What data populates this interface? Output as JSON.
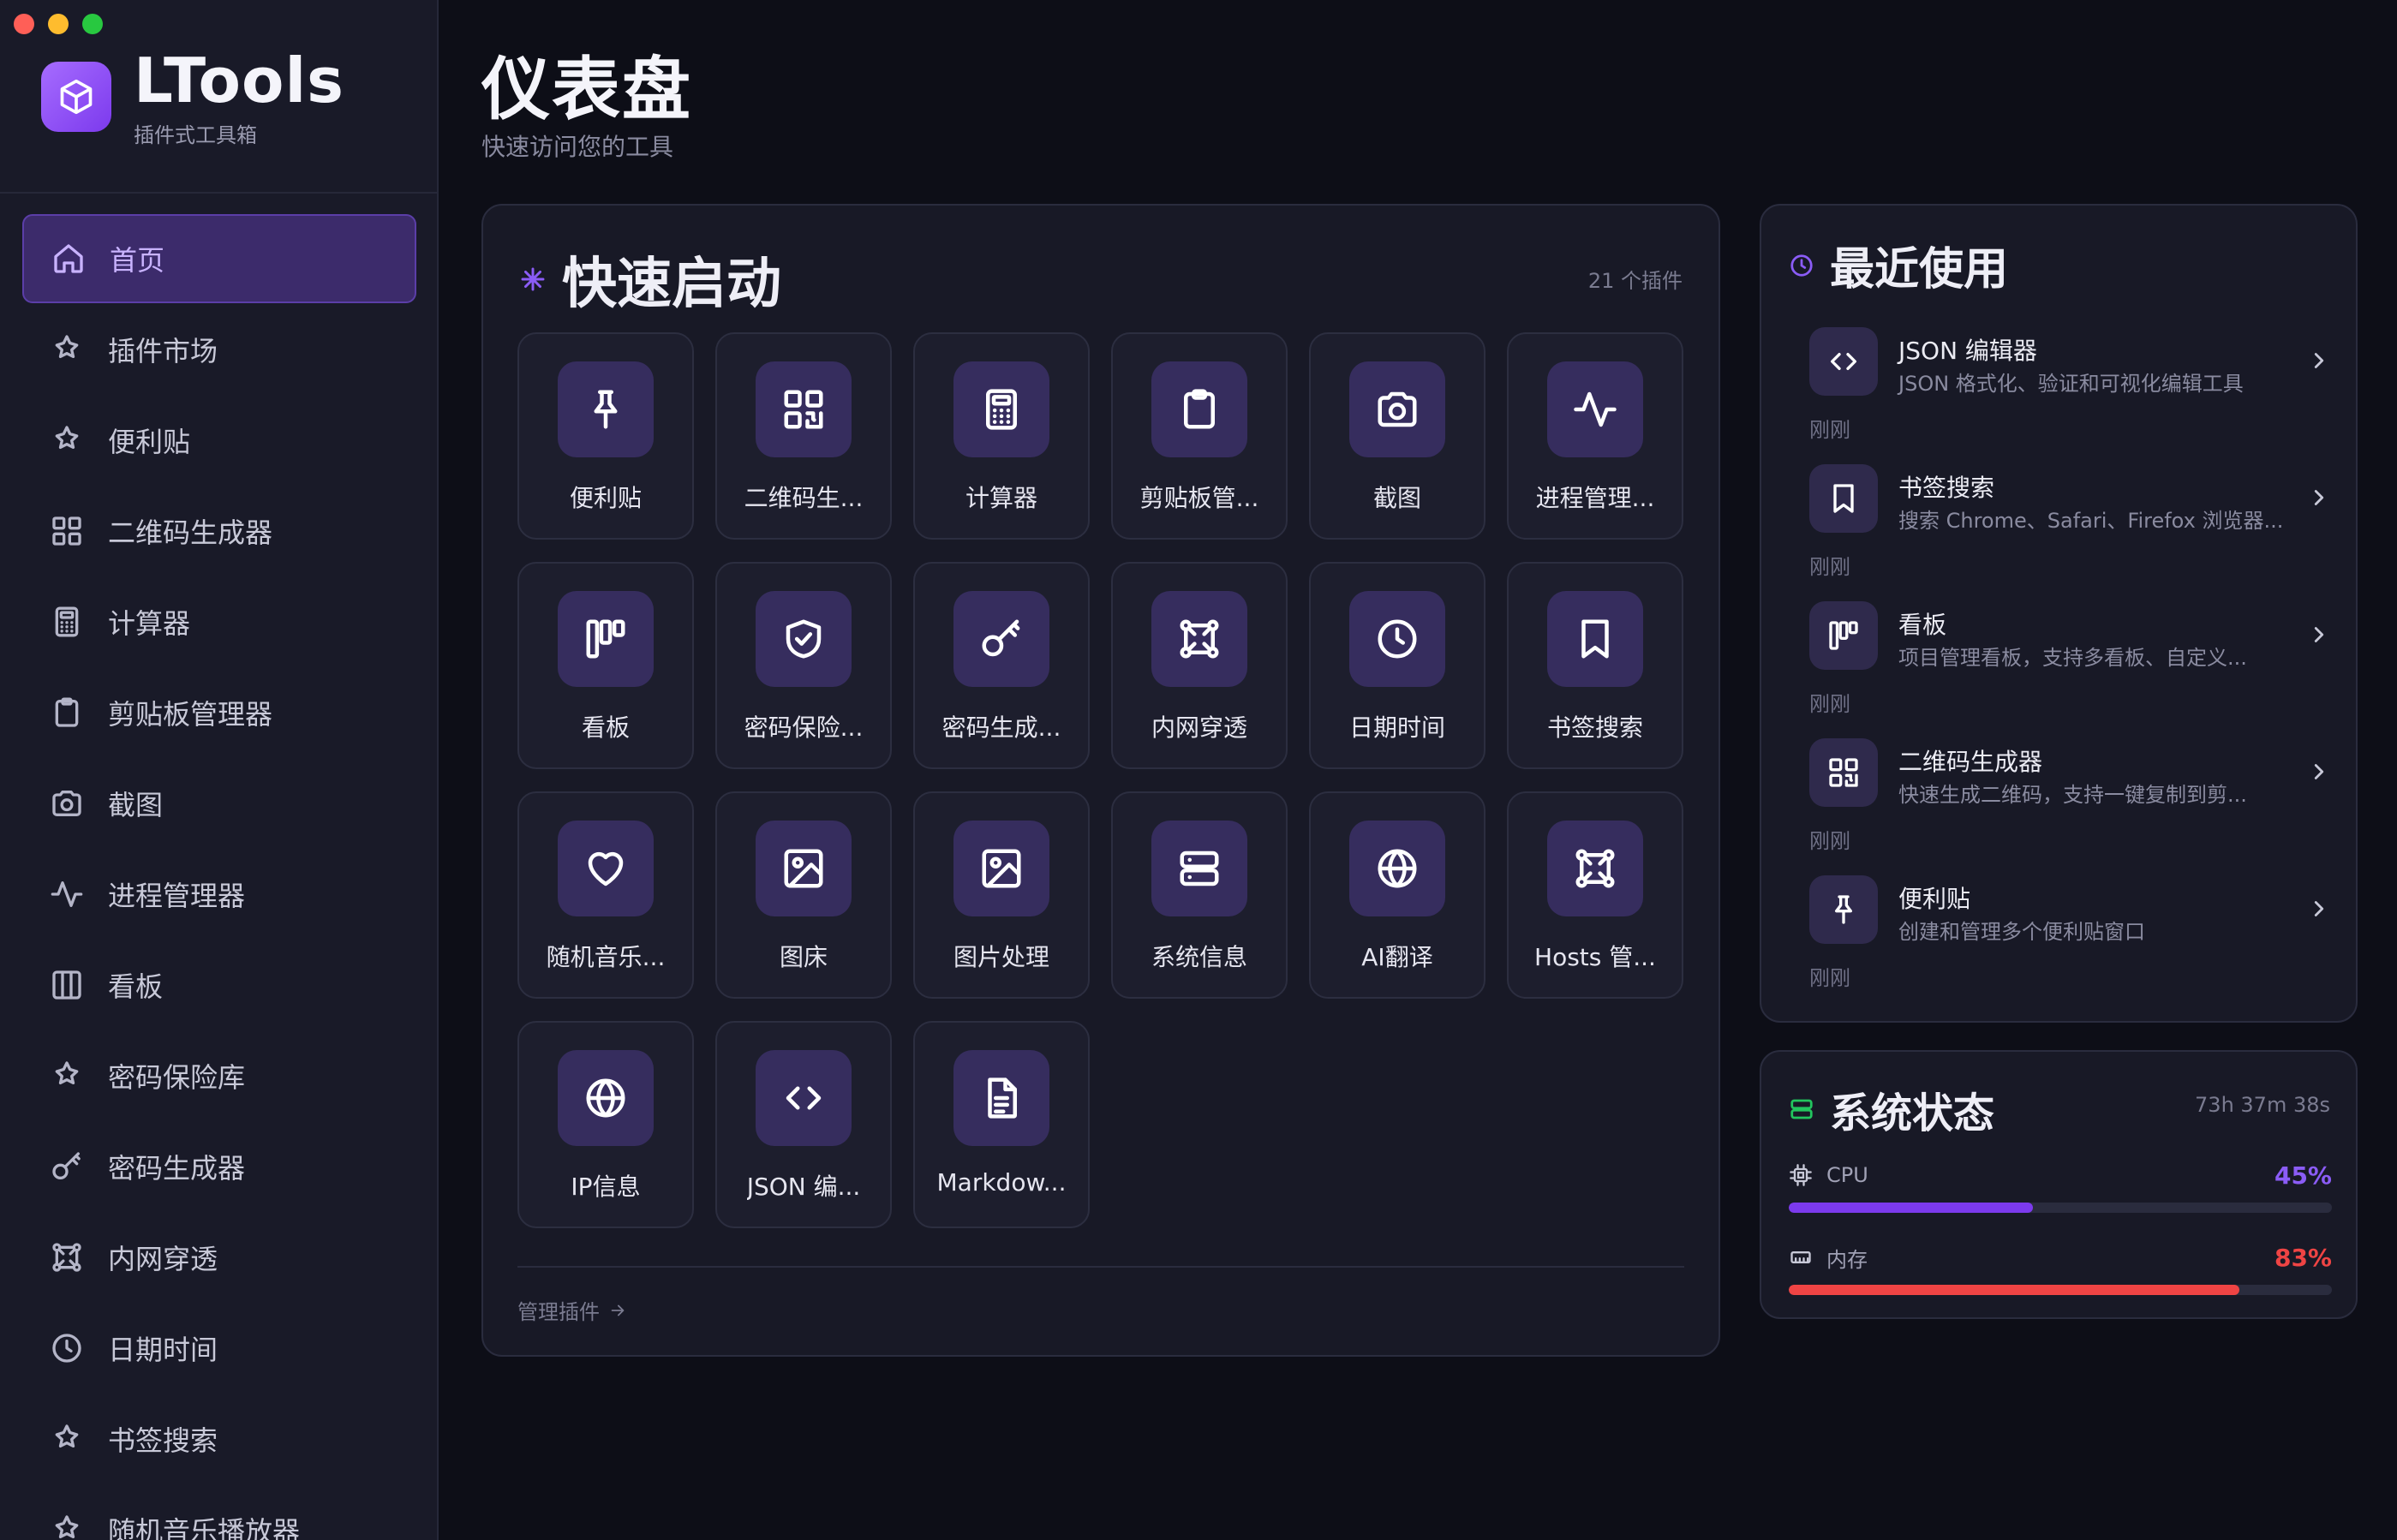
{
  "app": {
    "title": "LTools",
    "subtitle": "插件式工具箱",
    "accent": "#8b5cf6"
  },
  "sidebar": {
    "items": [
      {
        "label": "首页",
        "icon": "home-icon",
        "active": true
      },
      {
        "label": "插件市场",
        "icon": "puzzle-icon"
      },
      {
        "label": "便利贴",
        "icon": "puzzle-icon"
      },
      {
        "label": "二维码生成器",
        "icon": "grid-icon"
      },
      {
        "label": "计算器",
        "icon": "calculator-icon"
      },
      {
        "label": "剪贴板管理器",
        "icon": "clipboard-icon"
      },
      {
        "label": "截图",
        "icon": "camera-icon"
      },
      {
        "label": "进程管理器",
        "icon": "activity-icon"
      },
      {
        "label": "看板",
        "icon": "columns-icon"
      },
      {
        "label": "密码保险库",
        "icon": "puzzle-icon"
      },
      {
        "label": "密码生成器",
        "icon": "key-icon"
      },
      {
        "label": "内网穿透",
        "icon": "network-icon"
      },
      {
        "label": "日期时间",
        "icon": "clock-icon"
      },
      {
        "label": "书签搜索",
        "icon": "puzzle-icon"
      },
      {
        "label": "随机音乐播放器",
        "icon": "puzzle-icon"
      }
    ]
  },
  "header": {
    "title": "仪表盘",
    "subtitle": "快速访问您的工具"
  },
  "quick": {
    "title": "快速启动",
    "count": "21 个插件",
    "manage": "管理插件",
    "tiles": [
      {
        "label": "便利贴",
        "icon": "pin-icon"
      },
      {
        "label": "二维码生...",
        "icon": "qrcode-icon"
      },
      {
        "label": "计算器",
        "icon": "calculator-icon"
      },
      {
        "label": "剪贴板管...",
        "icon": "clipboard-icon"
      },
      {
        "label": "截图",
        "icon": "camera-icon"
      },
      {
        "label": "进程管理...",
        "icon": "activity-icon"
      },
      {
        "label": "看板",
        "icon": "kanban-icon"
      },
      {
        "label": "密码保险...",
        "icon": "shield-check-icon"
      },
      {
        "label": "密码生成...",
        "icon": "key-icon"
      },
      {
        "label": "内网穿透",
        "icon": "network-icon"
      },
      {
        "label": "日期时间",
        "icon": "clock-icon"
      },
      {
        "label": "书签搜索",
        "icon": "bookmark-icon"
      },
      {
        "label": "随机音乐...",
        "icon": "heart-icon"
      },
      {
        "label": "图床",
        "icon": "image-icon"
      },
      {
        "label": "图片处理",
        "icon": "image-icon"
      },
      {
        "label": "系统信息",
        "icon": "server-icon"
      },
      {
        "label": "AI翻译",
        "icon": "globe-icon"
      },
      {
        "label": "Hosts 管...",
        "icon": "network-icon"
      },
      {
        "label": "IP信息",
        "icon": "globe-icon"
      },
      {
        "label": "JSON 编...",
        "icon": "code-icon"
      },
      {
        "label": "Markdow...",
        "icon": "file-text-icon"
      }
    ]
  },
  "recent": {
    "title": "最近使用",
    "items": [
      {
        "title": "JSON 编辑器",
        "desc": "JSON 格式化、验证和可视化编辑工具",
        "time": "刚刚",
        "icon": "code-icon"
      },
      {
        "title": "书签搜索",
        "desc": "搜索 Chrome、Safari、Firefox 浏览器...",
        "time": "刚刚",
        "icon": "bookmark-icon"
      },
      {
        "title": "看板",
        "desc": "项目管理看板，支持多看板、自定义...",
        "time": "刚刚",
        "icon": "kanban-icon"
      },
      {
        "title": "二维码生成器",
        "desc": "快速生成二维码，支持一键复制到剪...",
        "time": "刚刚",
        "icon": "qrcode-icon"
      },
      {
        "title": "便利贴",
        "desc": "创建和管理多个便利贴窗口",
        "time": "刚刚",
        "icon": "pin-icon"
      }
    ]
  },
  "system": {
    "title": "系统状态",
    "uptime": "73h 37m 38s",
    "cpu": {
      "label": "CPU",
      "value": "45%",
      "percent": 45,
      "color": "#7c3aed"
    },
    "memory": {
      "label": "内存",
      "value": "83%",
      "percent": 83,
      "color": "#ef4444"
    }
  }
}
